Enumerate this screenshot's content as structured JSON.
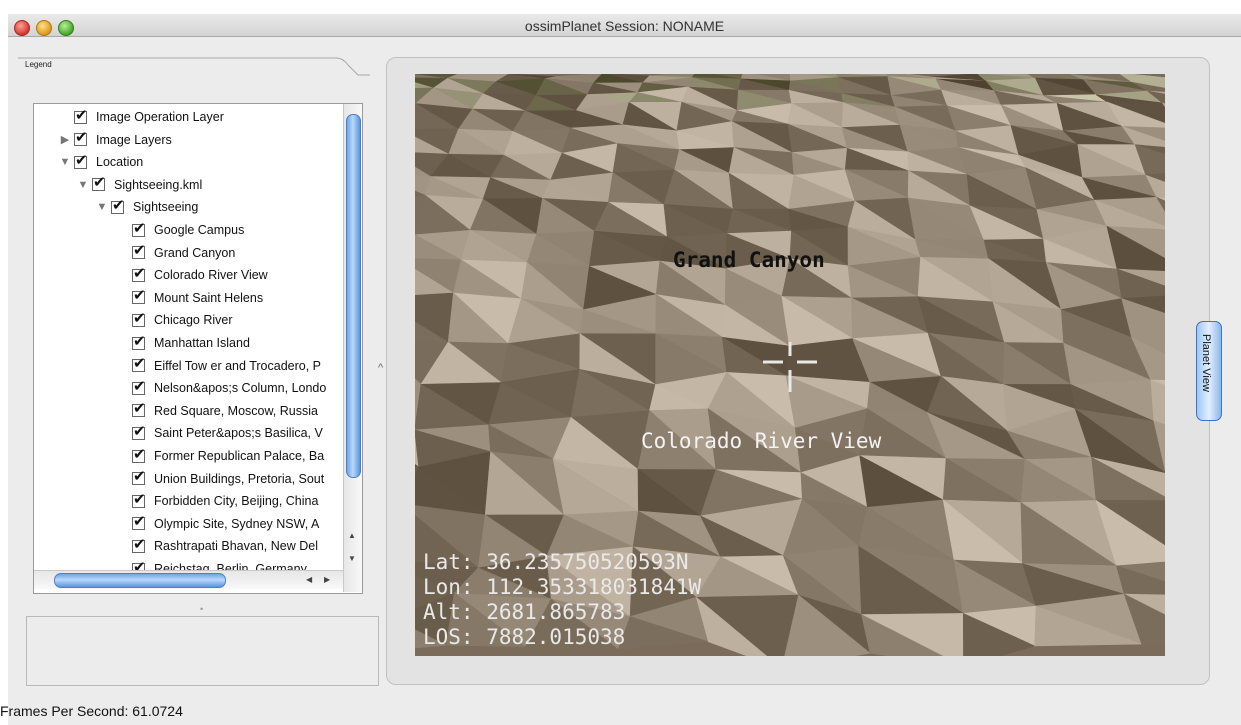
{
  "window": {
    "title": "ossimPlanet Session: NONAME"
  },
  "legend_tab": {
    "label": "Legend"
  },
  "tree": [
    {
      "label": "Image Operation Layer",
      "level": 0,
      "expander": ""
    },
    {
      "label": "Image Layers",
      "level": 0,
      "expander": "collapsed"
    },
    {
      "label": "Location",
      "level": 0,
      "expander": "expanded"
    },
    {
      "label": "Sightseeing.kml",
      "level": 1,
      "expander": "expanded"
    },
    {
      "label": "Sightseeing",
      "level": 2,
      "expander": "expanded"
    },
    {
      "label": "Google Campus",
      "level": 3,
      "expander": ""
    },
    {
      "label": "Grand Canyon",
      "level": 3,
      "expander": ""
    },
    {
      "label": "Colorado River View",
      "level": 3,
      "expander": ""
    },
    {
      "label": "Mount Saint Helens",
      "level": 3,
      "expander": ""
    },
    {
      "label": "Chicago River",
      "level": 3,
      "expander": ""
    },
    {
      "label": "Manhattan Island",
      "level": 3,
      "expander": ""
    },
    {
      "label": "Eiffel Tow er and Trocadero, P",
      "level": 3,
      "expander": ""
    },
    {
      "label": "Nelson&apos;s Column, Londo",
      "level": 3,
      "expander": ""
    },
    {
      "label": "Red Square, Moscow, Russia",
      "level": 3,
      "expander": ""
    },
    {
      "label": "Saint Peter&apos;s Basilica, V",
      "level": 3,
      "expander": ""
    },
    {
      "label": "Former Republican Palace, Ba",
      "level": 3,
      "expander": ""
    },
    {
      "label": "Union Buildings, Pretoria, Sout",
      "level": 3,
      "expander": ""
    },
    {
      "label": "Forbidden City, Beijing, China",
      "level": 3,
      "expander": ""
    },
    {
      "label": "Olympic Site, Sydney NSW, A",
      "level": 3,
      "expander": ""
    },
    {
      "label": "Rashtrapati Bhavan, New Del",
      "level": 3,
      "expander": ""
    },
    {
      "label": "Reichstag, Berlin, Germany",
      "level": 3,
      "expander": ""
    }
  ],
  "viewer": {
    "label_grand_canyon": "Grand Canyon",
    "label_colorado": "Colorado River View",
    "lat": "Lat: 36.235750520593N",
    "lon": "Lon: 112.353318031841W",
    "alt": "Alt: 2681.865783",
    "los": "LOS: 7882.015038"
  },
  "side_button": {
    "label": "Planet View"
  },
  "status": {
    "fps": "Frames Per Second: 61.0724"
  },
  "icons": {
    "check": "checkmark-icon",
    "disclosure_open": "triangle-down-icon",
    "disclosure_closed": "triangle-right-icon",
    "crosshair": "crosshair-icon"
  }
}
